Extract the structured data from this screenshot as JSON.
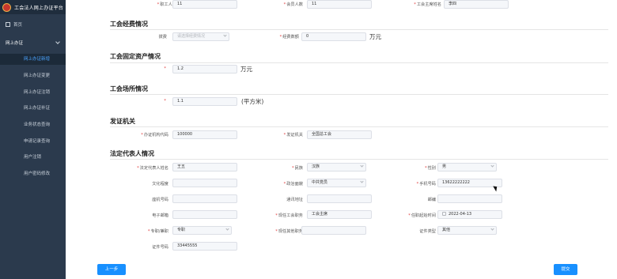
{
  "sidebar": {
    "title": "工会法人网上办证平台",
    "home": "首页",
    "group": "网上办证",
    "items": [
      "网上办证新增",
      "网上办证变更",
      "网上办证注销",
      "网上办证补证",
      "业务状态查询",
      "申请记录查询",
      "用户注销",
      "用户密码修改"
    ],
    "active_index": 0
  },
  "top_row": {
    "staff_count": {
      "label": "职工人数",
      "value": "11"
    },
    "member_count": {
      "label": "会员人数",
      "value": "11"
    },
    "chairman_name": {
      "label": "工会主席姓名",
      "value": "李四"
    }
  },
  "funding": {
    "title": "工会经费情况",
    "fee_label": "拨费",
    "fee_placeholder": "请选择经费情况",
    "amount_label": "经费数额",
    "amount_value": "0",
    "amount_unit": "万元"
  },
  "fixed_assets": {
    "title": "工会固定资产情况",
    "value": "1.2",
    "unit": "万元"
  },
  "venue": {
    "title": "工会场所情况",
    "value": "1.1",
    "unit": "(平方米)"
  },
  "issuer": {
    "title": "发证机关",
    "code_label": "办证机构代码",
    "code_value": "100000",
    "office_label": "发证机关",
    "office_value": "全国总工会"
  },
  "legal_rep": {
    "title": "法定代表人情况",
    "name_label": "法定代表人姓名",
    "name_value": "王五",
    "ethnicity_label": "民族",
    "ethnicity_value": "汉族",
    "gender_label": "性别",
    "gender_value": "男",
    "education_label": "文化程度",
    "education_value": "",
    "politics_label": "政治面貌",
    "politics_value": "中共党员",
    "phone_label": "手机号码",
    "phone_value": "13622222222",
    "landline_label": "座机号码",
    "landline_value": "",
    "address_label": "通讯地址",
    "address_value": "",
    "postcode_label": "邮编",
    "postcode_value": "",
    "email_label": "电子邮箱",
    "email_value": "",
    "union_post_label": "现任工会职务",
    "union_post_value": "工会主席",
    "start_label": "任职起始时间",
    "start_value": "2022-04-13",
    "fulltime_label": "专职/兼职",
    "fulltime_value": "专职",
    "other_post_label": "现任其他职务",
    "other_post_value": "",
    "id_type_label": "证件类型",
    "id_type_value": "其他",
    "id_no_label": "证件号码",
    "id_no_value": "33445555"
  },
  "buttons": {
    "prev": "上一步",
    "submit": "提交"
  },
  "colors": {
    "sidebar_bg": "#2b3a4d",
    "accent": "#1890ff",
    "required": "#e03b3b"
  }
}
